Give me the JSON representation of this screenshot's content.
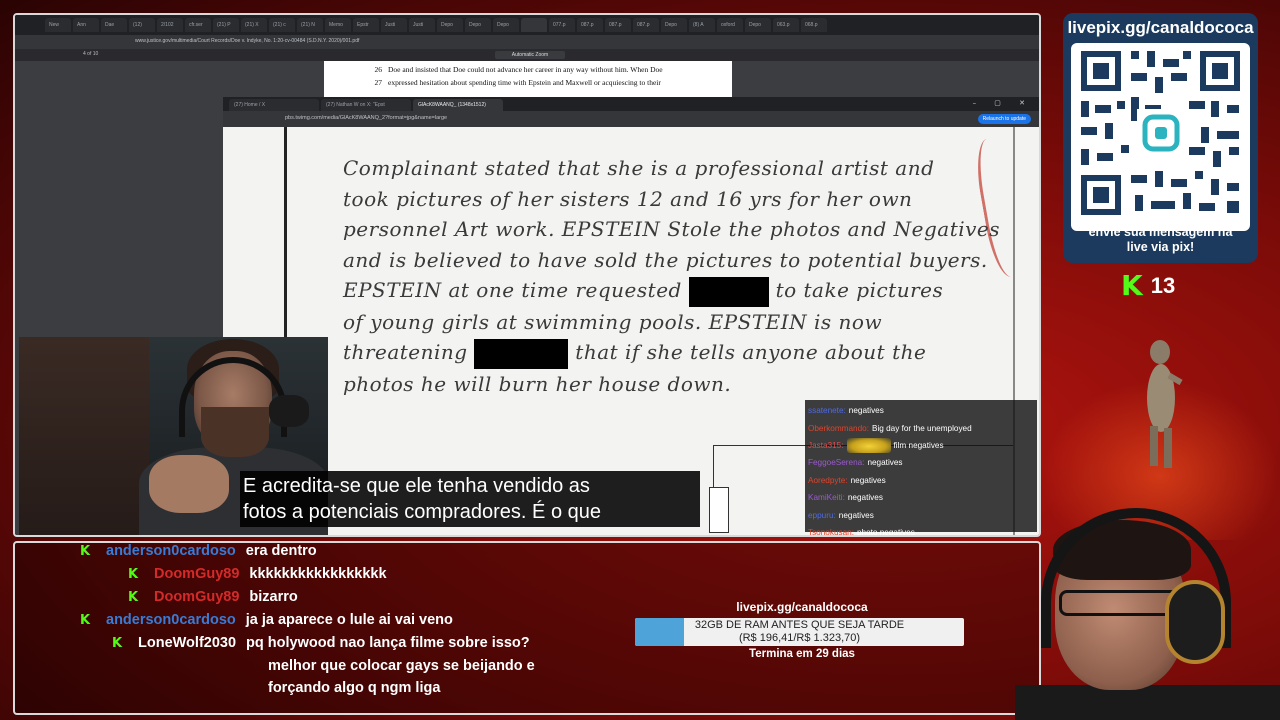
{
  "pdf_browser": {
    "tabs": [
      "New",
      "Ann",
      "Dae",
      "(12)",
      "2/102",
      "cfr.ser",
      "(21) P",
      "(21) X",
      "(21) c",
      "(21) N",
      "Memo",
      "Epstr",
      "Justi",
      "Justi",
      "Depo",
      "Depo",
      "Depo",
      "",
      "077.p",
      "087.p",
      "087.p",
      "087.p",
      "Depo",
      "(8) A",
      "oxford",
      "Depo",
      "063.p",
      "068.p"
    ],
    "active_tab_index": 17,
    "url": "www.justice.gov/multimedia/Court Records/Doe v. Indyke, No. 1:20-cv-00484 (S.D.N.Y. 2020)/001.pdf",
    "page_counter": "4 of 10",
    "zoom": "Automatic Zoom",
    "lines": [
      {
        "no": "26",
        "text": "Doe and insisted that Doe could not advance her career in any way without him.  When Doe"
      },
      {
        "no": "27",
        "text": "expressed hesitation about spending time with Epstein and Maxwell or acquiescing to their"
      }
    ]
  },
  "image_browser": {
    "tabs": [
      "(27) Home / X",
      "(27) Nathan W on X: \"Epst",
      "GlAcK8WAANQ_ (1348x1512)"
    ],
    "active_tab_index": 2,
    "url": "pbs.twimg.com/media/GlAcK8WAANQ_2?format=jpg&name=large",
    "refresh_button": "Relaunch to update",
    "window_controls": "– ▢ ✕"
  },
  "scan": {
    "line1": "Complainant stated that she is a professional artist and",
    "line2": "took pictures of her sisters 12 and 16 yrs for her own",
    "line3": "personnel Art work.  EPSTEIN Stole the photos and Negatives",
    "line4": "and is believed to have sold the pictures to potential buyers.",
    "line5a": "EPSTEIN at one time requested",
    "line5b": "to take pictures",
    "line6": "of young girls at swimming pools.  EPSTEIN is now",
    "line7a": "threatening",
    "line7b": "that if she tells anyone about the",
    "line8": "photos he will burn her house down."
  },
  "video_chat": [
    {
      "user": "ssatenete:",
      "color": "#4f6be0",
      "msg": "negatives"
    },
    {
      "user": "Oberkommando:",
      "color": "#e0432b",
      "msg": "Big day for the unemployed"
    },
    {
      "user": "Jasta315:",
      "color": "#e54b4b",
      "msg": "film negatives",
      "emote": true
    },
    {
      "user": "FeggoeSerena:",
      "color": "#9b59d0",
      "msg": "negatives"
    },
    {
      "user": "Aoredpyte:",
      "color": "#e0432b",
      "msg": "negatives"
    },
    {
      "user": "KamiKeiti:",
      "color": "#9b59d0",
      "msg": "negatives"
    },
    {
      "user": "eppuru:",
      "color": "#4f6be0",
      "msg": "negatives"
    },
    {
      "user": "Tsonokusan:",
      "color": "#e0432b",
      "msg": "photo negatives"
    }
  ],
  "subtitles": {
    "line1": "E acredita-se que ele tenha vendido as",
    "line2": "fotos a potenciais compradores.  É o que"
  },
  "livepix": {
    "url": "livepix.gg/canaldococa",
    "caption_line1": "envie sua mensagem na",
    "caption_line2": "live via pix!"
  },
  "kick_counter": {
    "logo": "K",
    "count": "13"
  },
  "chat": {
    "badge": "K",
    "messages": [
      {
        "user": "anderson0cardoso",
        "color": "#3a7bd5",
        "msg": "era dentro",
        "indent": 0
      },
      {
        "user": "DoomGuy89",
        "color": "#d42a2a",
        "msg": "kkkkkkkkkkkkkkkkk",
        "indent": 48
      },
      {
        "user": "DoomGuy89",
        "color": "#d42a2a",
        "msg": "bizarro",
        "indent": 48
      },
      {
        "user": "anderson0cardoso",
        "color": "#3a7bd5",
        "msg": "ja ja aparece o lule ai vai veno",
        "indent": 0
      },
      {
        "user": "LoneWolf2030",
        "color": "#ffffff",
        "msg": "pq holywood nao lança filme sobre isso?",
        "indent": 32
      }
    ],
    "continuation": [
      "melhor que colocar gays se beijando e",
      "forçando algo q ngm liga"
    ]
  },
  "goal": {
    "title": "livepix.gg/canaldococa",
    "label_line1": "32GB DE RAM ANTES QUE SEJA TARDE",
    "label_line2": "(R$ 196,41/R$ 1.323,70)",
    "current": 196.41,
    "target": 1323.7,
    "footer": "Termina em 29 dias",
    "fill_color": "#4ea3d8"
  },
  "colors": {
    "background": "#7a0b08",
    "kick_green": "#53fc18",
    "qr_panel": "#1b3a5e"
  }
}
